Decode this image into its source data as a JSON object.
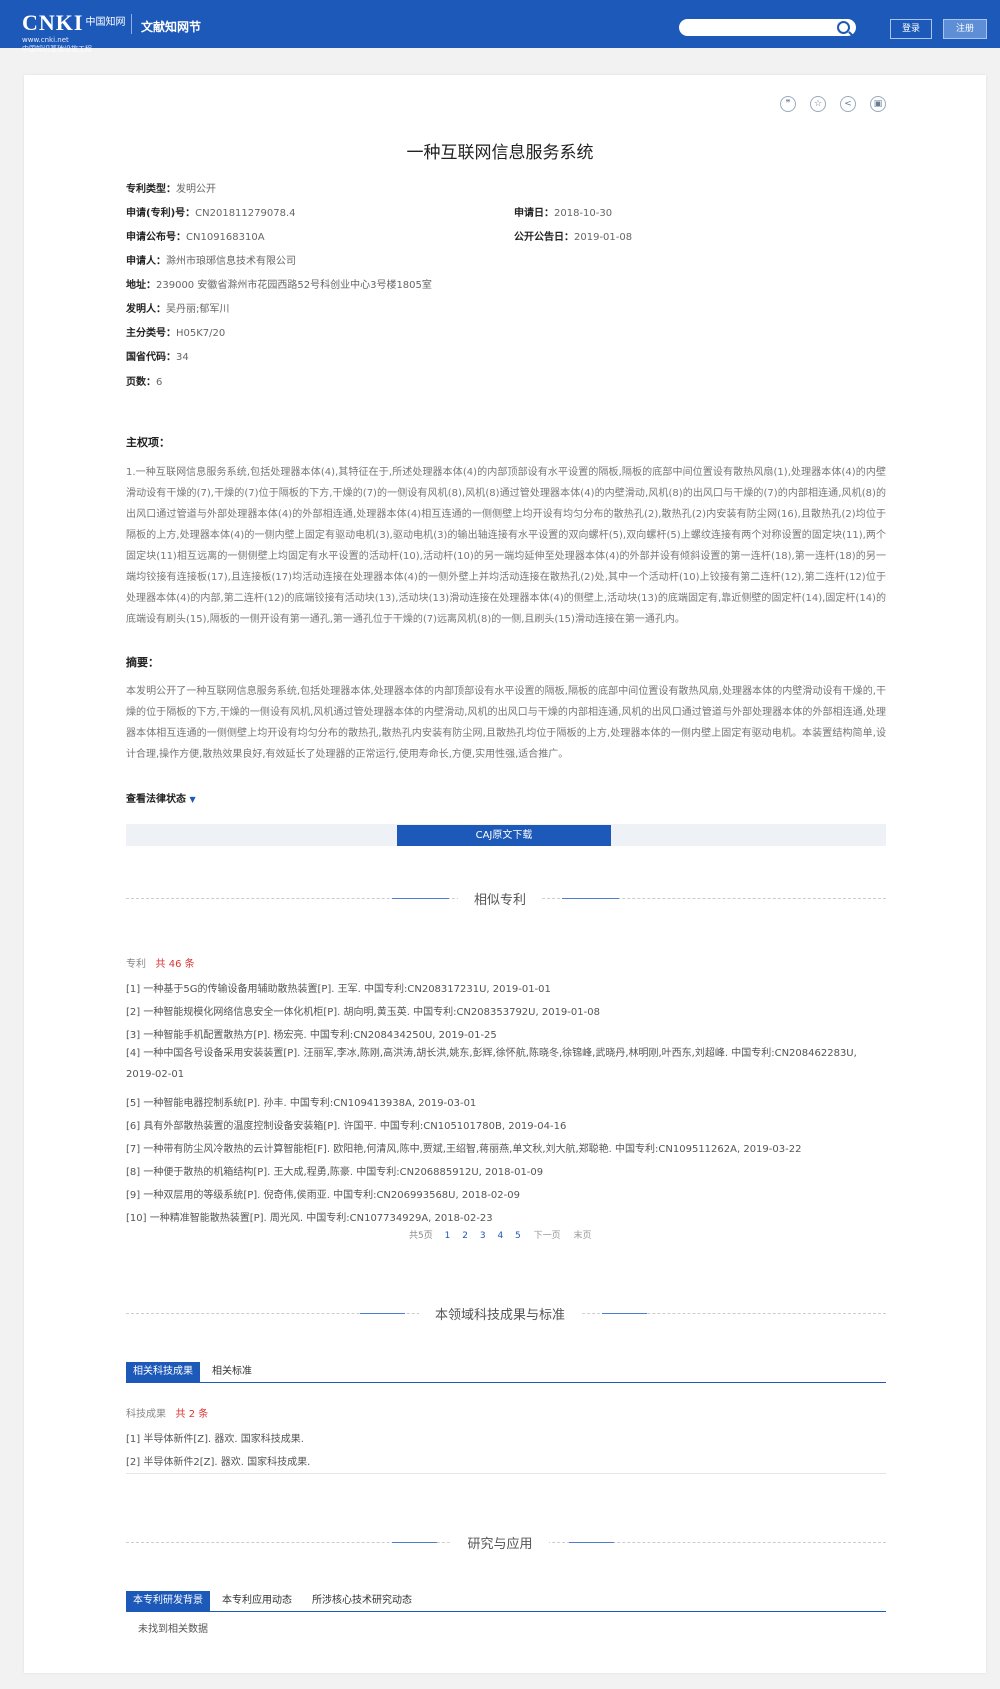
{
  "header": {
    "logo_main": "CNKI",
    "logo_cn": "中国知网",
    "logo_url": "www.cnki.net",
    "logo_sub": "中国知识基础设施工程",
    "site_name": "文献知网节",
    "search_placeholder": "",
    "login_label": "登录",
    "register_label": "注册"
  },
  "toolbar": {
    "quote_icon": "quote-icon",
    "star_icon": "star-icon",
    "share_icon": "share-icon",
    "print_icon": "print-icon"
  },
  "patent": {
    "title": "一种互联网信息服务系统",
    "fields": {
      "type_label": "专利类型：",
      "type_value": "发明公开",
      "app_no_label": "申请(专利)号：",
      "app_no_value": "CN201811279078.4",
      "app_date_label": "申请日：",
      "app_date_value": "2018-10-30",
      "pub_no_label": "申请公布号：",
      "pub_no_value": "CN109168310A",
      "pub_date_label": "公开公告日：",
      "pub_date_value": "2019-01-08",
      "applicant_label": "申请人：",
      "applicant_value": "滁州市琅琊信息技术有限公司",
      "address_label": "地址：",
      "address_value": "239000 安徽省滁州市花园西路52号科创业中心3号楼1805室",
      "inventor_label": "发明人：",
      "inventor_value": "吴丹丽;郁军川",
      "class_label": "主分类号：",
      "class_value": "H05K7/20",
      "province_label": "国省代码：",
      "province_value": "34",
      "pages_label": "页数：",
      "pages_value": "6"
    },
    "claim_heading": "主权项：",
    "claim_text": "1.一种互联网信息服务系统,包括处理器本体(4),其特征在于,所述处理器本体(4)的内部顶部设有水平设置的隔板,隔板的底部中间位置设有散热风扇(1),处理器本体(4)的内壁滑动设有干燥的(7),干燥的(7)位于隔板的下方,干燥的(7)的一侧设有风机(8),风机(8)通过管处理器本体(4)的内壁滑动,风机(8)的出风口与干燥的(7)的内部相连通,风机(8)的出风口通过管道与外部处理器本体(4)的外部相连通,处理器本体(4)相互连通的一侧侧壁上均开设有均匀分布的散热孔(2),散热孔(2)内安装有防尘网(16),且散热孔(2)均位于隔板的上方,处理器本体(4)的一侧内壁上固定有驱动电机(3),驱动电机(3)的输出轴连接有水平设置的双向螺杆(5),双向螺杆(5)上螺纹连接有两个对称设置的固定块(11),两个固定块(11)相互远离的一侧侧壁上均固定有水平设置的活动杆(10),活动杆(10)的另一端均延伸至处理器本体(4)的外部并设有倾斜设置的第一连杆(18),第一连杆(18)的另一端均铰接有连接板(17),且连接板(17)均活动连接在处理器本体(4)的一侧外壁上并均活动连接在散热孔(2)处,其中一个活动杆(10)上铰接有第二连杆(12),第二连杆(12)位于处理器本体(4)的内部,第二连杆(12)的底端铰接有活动块(13),活动块(13)滑动连接在处理器本体(4)的侧壁上,活动块(13)的底端固定有,靠近侧壁的固定杆(14),固定杆(14)的底端设有刷头(15),隔板的一侧开设有第一通孔,第一通孔位于干燥的(7)远离风机(8)的一侧,且刷头(15)滑动连接在第一通孔内。",
    "abstract_heading": "摘要：",
    "abstract_text": "本发明公开了一种互联网信息服务系统,包括处理器本体,处理器本体的内部顶部设有水平设置的隔板,隔板的底部中间位置设有散热风扇,处理器本体的内壁滑动设有干燥的,干燥的位于隔板的下方,干燥的一侧设有风机,风机通过管处理器本体的内壁滑动,风机的出风口与干燥的内部相连通,风机的出风口通过管道与外部处理器本体的外部相连通,处理器本体相互连通的一侧侧壁上均开设有均匀分布的散热孔,散热孔内安装有防尘网,且散热孔均位于隔板的上方,处理器本体的一侧内壁上固定有驱动电机。本装置结构简单,设计合理,操作方便,散热效果良好,有效延长了处理器的正常运行,使用寿命长,方便,实用性强,适合推广。",
    "law_status_label": "查看法律状态",
    "download_label": "CAJ原文下载"
  },
  "similar": {
    "heading": "相似专利",
    "count_prefix": "专利",
    "count_value": "共 46 条",
    "items": [
      "[1] 一种基于5G的传输设备用辅助散热装置[P]. 王军. 中国专利:CN208317231U, 2019-01-01",
      "[2] 一种智能规模化网络信息安全一体化机柜[P]. 胡向明,黄玉英. 中国专利:CN208353792U, 2019-01-08",
      "[3] 一种智能手机配置散热方[P]. 杨宏亮. 中国专利:CN208434250U, 2019-01-25",
      "[4] 一种中国各号设备采用安装装置[P]. 汪丽军,李冰,陈刚,高洪涛,胡长洪,姚东,彭辉,徐怀航,陈晓冬,徐锦峰,武晓丹,林明刚,叶西东,刘超峰. 中国专利:CN208462283U, 2019-02-01",
      "[5] 一种智能电器控制系统[P]. 孙丰. 中国专利:CN109413938A, 2019-03-01",
      "[6] 具有外部散热装置的温度控制设备安装箱[P]. 许国平. 中国专利:CN105101780B, 2019-04-16",
      "[7] 一种带有防尘风冷散热的云计算智能柜[F]. 欧阳艳,何清风,陈中,贾斌,王绍智,蒋丽燕,单文秋,刘大航,郑聪艳. 中国专利:CN109511262A, 2019-03-22",
      "[8] 一种便于散热的机箱结构[P]. 王大成,程勇,陈豪. 中国专利:CN206885912U, 2018-01-09",
      "[9] 一种双层用的等级系统[P]. 倪奇伟,侯雨亚. 中国专利:CN206993568U, 2018-02-09",
      "[10] 一种精准智能散热装置[P]. 周光风. 中国专利:CN107734929A, 2018-02-23"
    ],
    "pager": {
      "total": "共5页",
      "pages": [
        "1",
        "2",
        "3",
        "4",
        "5"
      ],
      "next": "下一页",
      "last": "末页"
    }
  },
  "tech": {
    "heading": "本领域科技成果与标准",
    "tab_active": "相关科技成果",
    "tab_idle": "相关标准",
    "count_prefix": "科技成果",
    "count_value": "共 2 条",
    "items": [
      "[1] 半导体新件[Z]. 器欢. 国家科技成果.",
      "[2] 半导体新件2[Z]. 器欢. 国家科技成果."
    ]
  },
  "research": {
    "heading": "研究与应用",
    "tabs": [
      "本专利研发背景",
      "本专利应用动态",
      "所涉核心技术研究动态"
    ],
    "empty": "未找到相关数据"
  }
}
